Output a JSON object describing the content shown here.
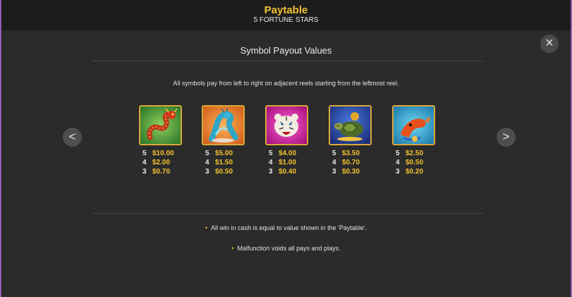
{
  "header": {
    "title": "Paytable",
    "subtitle": "5 FORTUNE STARS"
  },
  "section_title": "Symbol Payout Values",
  "intro": "All symbols pay from left to right on adjacent reels starting from the leftmost reel.",
  "nav": {
    "prev": "<",
    "next": ">"
  },
  "close": "×",
  "symbols": [
    {
      "icon": "dragon-icon",
      "pays": [
        {
          "count": "5",
          "value": "$10.00"
        },
        {
          "count": "4",
          "value": "$2.00"
        },
        {
          "count": "3",
          "value": "$0.70"
        }
      ]
    },
    {
      "icon": "phoenix-icon",
      "pays": [
        {
          "count": "5",
          "value": "$5.00"
        },
        {
          "count": "4",
          "value": "$1.50"
        },
        {
          "count": "3",
          "value": "$0.50"
        }
      ]
    },
    {
      "icon": "tiger-icon",
      "pays": [
        {
          "count": "5",
          "value": "$4.00"
        },
        {
          "count": "4",
          "value": "$1.00"
        },
        {
          "count": "3",
          "value": "$0.40"
        }
      ]
    },
    {
      "icon": "turtle-icon",
      "pays": [
        {
          "count": "5",
          "value": "$3.50"
        },
        {
          "count": "4",
          "value": "$0.70"
        },
        {
          "count": "3",
          "value": "$0.30"
        }
      ]
    },
    {
      "icon": "koi-fish-icon",
      "pays": [
        {
          "count": "5",
          "value": "$2.50"
        },
        {
          "count": "4",
          "value": "$0.50"
        },
        {
          "count": "3",
          "value": "$0.20"
        }
      ]
    }
  ],
  "notes": [
    "All win in cash is equal to value shown in the 'Paytable'.",
    "Malfunction voids all pays and plays."
  ],
  "colors": {
    "accent": "#f3c234",
    "background": "#2b2b2b",
    "header": "#1c1c1c"
  }
}
